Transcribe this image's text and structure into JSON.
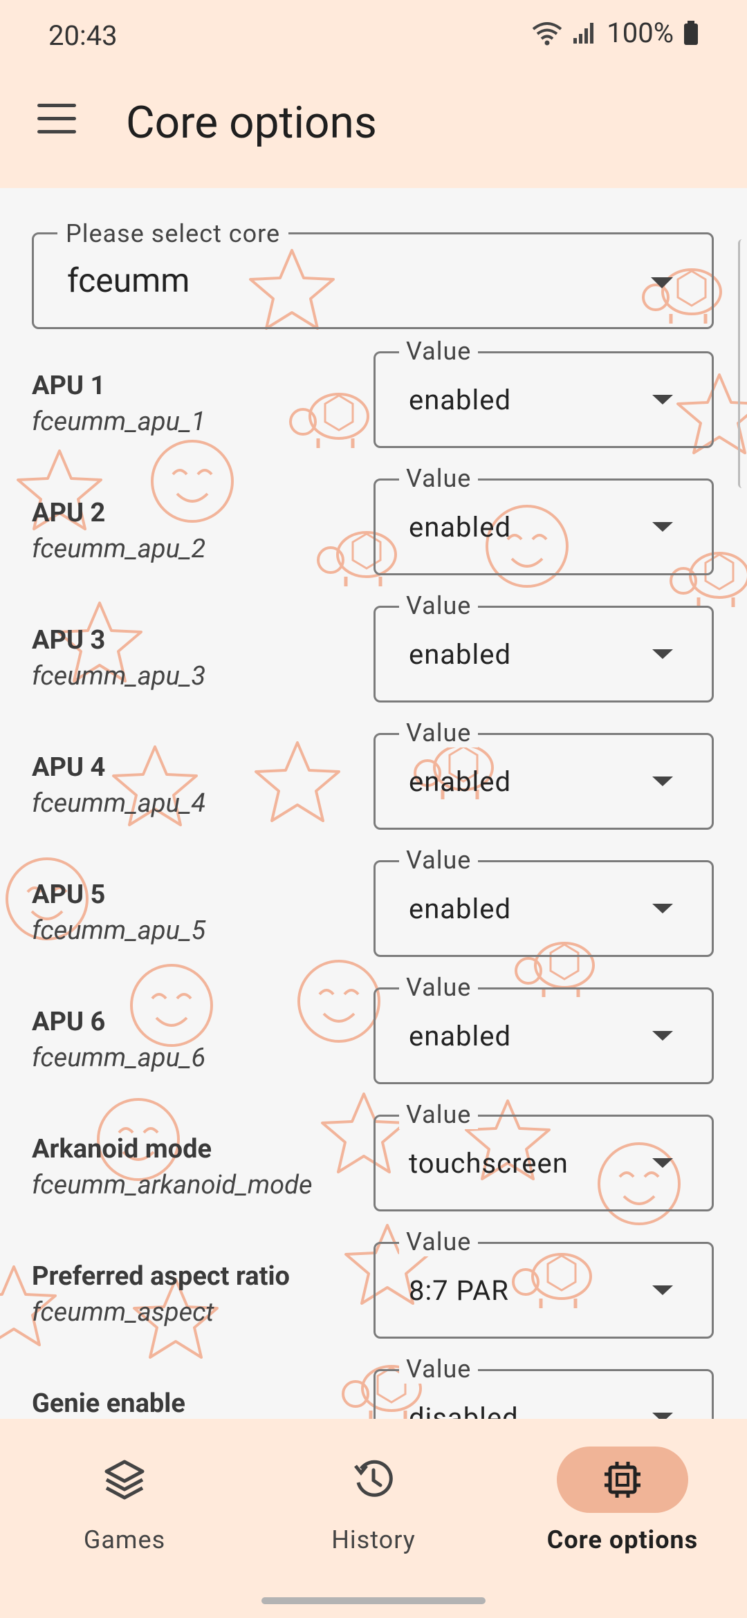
{
  "status_bar": {
    "time": "20:43",
    "battery": "100%"
  },
  "app_bar": {
    "title": "Core options"
  },
  "core_select": {
    "label": "Please select core",
    "value": "fceumm"
  },
  "options": [
    {
      "label": "APU 1",
      "key": "fceumm_apu_1",
      "field_label": "Value",
      "value": "enabled"
    },
    {
      "label": "APU 2",
      "key": "fceumm_apu_2",
      "field_label": "Value",
      "value": "enabled"
    },
    {
      "label": "APU 3",
      "key": "fceumm_apu_3",
      "field_label": "Value",
      "value": "enabled"
    },
    {
      "label": "APU 4",
      "key": "fceumm_apu_4",
      "field_label": "Value",
      "value": "enabled"
    },
    {
      "label": "APU 5",
      "key": "fceumm_apu_5",
      "field_label": "Value",
      "value": "enabled"
    },
    {
      "label": "APU 6",
      "key": "fceumm_apu_6",
      "field_label": "Value",
      "value": "enabled"
    },
    {
      "label": "Arkanoid mode",
      "key": "fceumm_arkanoid_mode",
      "field_label": "Value",
      "value": "touchscreen"
    },
    {
      "label": "Preferred aspect ratio",
      "key": "fceumm_aspect",
      "field_label": "Value",
      "value": "8:7 PAR"
    },
    {
      "label": "Genie enable",
      "key": "",
      "field_label": "Value",
      "value": "disabled"
    }
  ],
  "bottom_nav": {
    "items": [
      {
        "label": "Games",
        "icon": "layers-icon"
      },
      {
        "label": "History",
        "icon": "history-icon"
      },
      {
        "label": "Core options",
        "icon": "chip-icon",
        "active": true
      }
    ]
  },
  "colors": {
    "header_bg": "#ffeadb",
    "accent": "#f0b497",
    "decor": "#f2b49a"
  }
}
